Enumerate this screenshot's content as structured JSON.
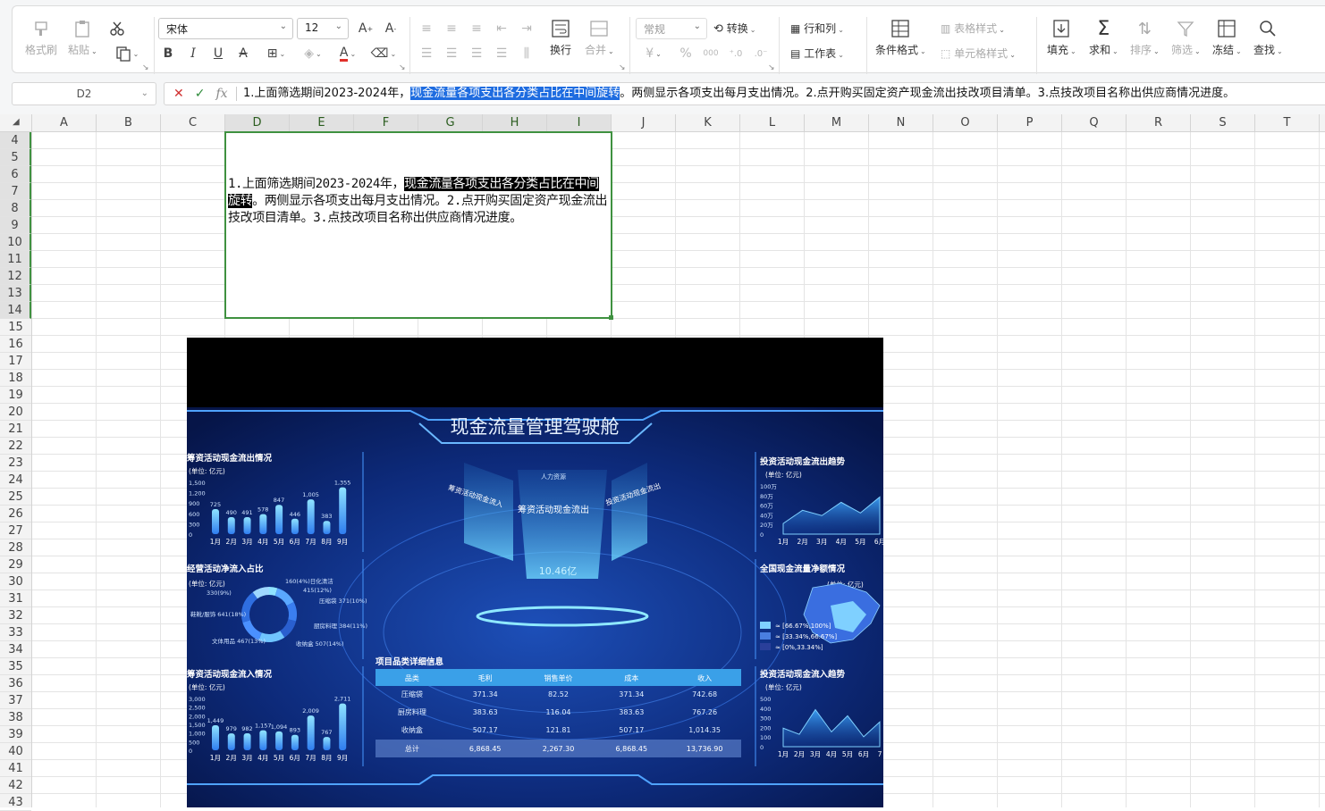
{
  "ribbon": {
    "format_painter": "格式刷",
    "paste": "粘贴",
    "font_name": "宋体",
    "font_size": "12",
    "number_format": "常规",
    "convert": "转换",
    "row_col": "行和列",
    "worksheet": "工作表",
    "wrap": "换行",
    "merge": "合并",
    "cond_format": "条件格式",
    "table_style": "表格样式",
    "cell_style": "单元格样式",
    "fill": "填充",
    "sum": "求和",
    "sort": "排序",
    "filter": "筛选",
    "freeze": "冻结",
    "find": "查找",
    "currency_symbol": "¥",
    "percent_symbol": "%",
    "thousands_symbol": "000"
  },
  "formula_bar": {
    "name_box": "D2",
    "text_before": "1.上面筛选期间2023-2024年，",
    "text_selected": "现金流量各项支出各分类占比在中间旋转",
    "text_after": "。两侧显示各项支出每月支出情况。2.点开购买固定资产现金流出技改项目清单。3.点技改项目名称出供应商情况进度。"
  },
  "columns": [
    "A",
    "B",
    "C",
    "D",
    "E",
    "F",
    "G",
    "H",
    "I",
    "J",
    "K",
    "L",
    "M",
    "N",
    "O",
    "P",
    "Q",
    "R",
    "S",
    "T"
  ],
  "rows": [
    "4",
    "5",
    "6",
    "7",
    "8",
    "9",
    "10",
    "11",
    "12",
    "13",
    "14",
    "15",
    "16",
    "17",
    "18",
    "19",
    "20",
    "21",
    "22",
    "23",
    "24",
    "25",
    "26",
    "27",
    "28",
    "29",
    "30",
    "31",
    "32",
    "33",
    "34",
    "35",
    "36",
    "37",
    "38",
    "39",
    "40",
    "41",
    "42",
    "43"
  ],
  "cell_text": {
    "before": "1.上面筛选期间2023-2024年，",
    "selected": "现金流量各项支出各分类占比在中间旋转",
    "after": "。两侧显示各项支出每月支出情况。2.点开购买固定资产现金流出技改项目清单。3.点技改项目名称出供应商情况进度。"
  },
  "dashboard": {
    "title": "现金流量管理驾驶舱",
    "center": {
      "label": "筹资活动现金流出",
      "value": "10.46亿",
      "side_left": "筹资活动现金流入",
      "side_right": "投资活动现金流出",
      "top": "人力资源"
    },
    "unit_label": "(单位: 亿元)",
    "months": [
      "1月",
      "2月",
      "3月",
      "4月",
      "5月",
      "6月",
      "7月",
      "8月",
      "9月"
    ],
    "chart_data": [
      {
        "type": "bar",
        "title": "筹资活动现金流出情况",
        "categories": [
          "1月",
          "2月",
          "3月",
          "4月",
          "5月",
          "6月",
          "7月",
          "8月",
          "9月"
        ],
        "values": [
          725,
          490,
          491,
          578,
          847,
          446,
          1005,
          383,
          1355
        ],
        "yticks": [
          "1,500",
          "1,200",
          "900",
          "600",
          "300",
          "0"
        ],
        "ylim": [
          0,
          1500
        ]
      },
      {
        "type": "pie",
        "title": "经营活动净流入占比",
        "labels": [
          "160(4%)日化清洁",
          "415(12%)",
          "压缩袋 371(10%)",
          "厨房料理 384(11%)",
          "收纳盒 507(14%)",
          "文体用品 467(13%)",
          "鞋靴/服饰 641(18%)",
          "330(9%)"
        ],
        "values": [
          160,
          415,
          371,
          384,
          507,
          467,
          641,
          330
        ]
      },
      {
        "type": "bar",
        "title": "筹资活动现金流入情况",
        "categories": [
          "1月",
          "2月",
          "3月",
          "4月",
          "5月",
          "6月",
          "7月",
          "8月",
          "9月"
        ],
        "values": [
          1449,
          979,
          982,
          1157,
          1094,
          893,
          2009,
          767,
          2711
        ],
        "yticks": [
          "3,000",
          "2,500",
          "2,000",
          "1,500",
          "1,000",
          "500",
          "0"
        ],
        "ylim": [
          0,
          3000
        ]
      },
      {
        "type": "area",
        "title": "投资活动现金流出趋势",
        "categories": [
          "1月",
          "2月",
          "3月",
          "4月",
          "5月",
          "6月"
        ],
        "yticks": [
          "100万",
          "80万",
          "60万",
          "40万",
          "20万",
          "0"
        ],
        "values": [
          20,
          45,
          35,
          60,
          40,
          70
        ]
      },
      {
        "type": "area",
        "title": "投资活动现金流入趋势",
        "categories": [
          "1月",
          "2月",
          "3月",
          "4月",
          "5月",
          "6月",
          "7"
        ],
        "yticks": [
          "500",
          "400",
          "300",
          "200",
          "100",
          "0"
        ],
        "values": [
          150,
          100,
          300,
          120,
          250,
          80,
          200
        ]
      }
    ],
    "map": {
      "title": "全国现金流量净额情况",
      "legend": [
        "≈ [66.67%,100%]",
        "≈ [33.34%,66.67%]",
        "≈ [0%,33.34%]"
      ],
      "colors": [
        "#7fd0ff",
        "#4a7fe0",
        "#2a3f9a"
      ]
    },
    "table": {
      "title": "项目品类详细信息",
      "headers": [
        "品类",
        "毛利",
        "销售单价",
        "成本",
        "收入"
      ],
      "rows": [
        [
          "压缩袋",
          "371.34",
          "82.52",
          "371.34",
          "742.68"
        ],
        [
          "厨房料理",
          "383.63",
          "116.04",
          "383.63",
          "767.26"
        ],
        [
          "收纳盒",
          "507.17",
          "121.81",
          "507.17",
          "1,014.35"
        ]
      ],
      "total": [
        "总计",
        "6,868.45",
        "2,267.30",
        "6,868.45",
        "13,736.90"
      ]
    }
  }
}
